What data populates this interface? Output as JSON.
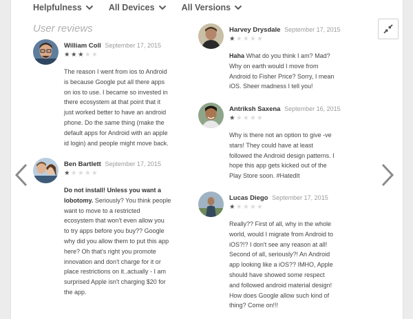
{
  "filters": [
    {
      "label": "Helpfulness"
    },
    {
      "label": "All Devices"
    },
    {
      "label": "All Versions"
    }
  ],
  "section_title": "User reviews",
  "reviews": [
    {
      "author": "William Coll",
      "date": "September 17, 2015",
      "rating": 3,
      "title": "",
      "lines": [
        "The reason I went from ios to Android",
        "is because Google put all there apps",
        "on ios to use. I became so invested in",
        "there ecosystem at that point that it",
        "just worked better to have an android",
        "phone. Do the same thing (make the",
        "default apps for Android with an apple",
        "id login) and people might move back."
      ]
    },
    {
      "author": "Ben Bartlett",
      "date": "September 17, 2015",
      "rating": 1,
      "title": "Do not install! Unless you want a lobotomy.",
      "lines": [
        "Do not install! Unless you want a",
        "lobotomy. Seriously? You think people",
        "want to move to a restricted",
        "ecosystem that won't even allow you",
        "to try apps before you buy?? Google",
        "why did you allow them to put this app",
        "here? Oh that's right you promote",
        "innovation and don't charge for it or",
        "place restrictions on it..actually - I am",
        "surprised Apple isn't charging $20 for",
        "the app."
      ]
    },
    {
      "author": "Harvey Drysdale",
      "date": "September 17, 2015",
      "rating": 1,
      "title": "Haha",
      "lines": [
        "Haha What do you think I am? Mad?",
        "Why on earth would I move from",
        "Android to Fisher Price? Sorry, I mean",
        "iOS. Sheer madness I tell you!"
      ]
    },
    {
      "author": "Antriksh Saxena",
      "date": "September 16, 2015",
      "rating": 1,
      "title": "",
      "lines": [
        "Why is there not an option to give -ve",
        "stars! They could have at least",
        "followed the Android design patterns. I",
        "hope this app gets kicked out of the",
        "Play Store soon. #HatedIt"
      ]
    },
    {
      "author": "Lucas Diego",
      "date": "September 17, 2015",
      "rating": 1,
      "title": "",
      "lines": [
        "Really?? First of all, why in the whole",
        "world, would I migrate from Android to",
        "iOS?!? I don't see any reason at all!",
        "Second of all, seriously?! An Android",
        "app looking like a iOS?? IMHO, Apple",
        "should have showed some respect",
        "and followed android material design!",
        "How does Google allow such kind of",
        "thing? Come on!!!"
      ]
    }
  ],
  "colors": {
    "star_on": "#555555",
    "star_off": "#dadada",
    "date": "#9a9a9a",
    "section_title": "#b0b0b0"
  }
}
